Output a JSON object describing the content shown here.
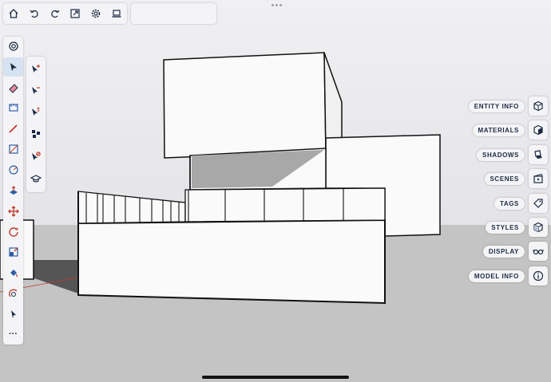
{
  "canvas": {
    "sky_color": "#e8e8ec",
    "ground_color": "#c4c4c4",
    "accent_color": "#1c2a44"
  },
  "top_toolbar": {
    "items": [
      {
        "icon": "home-icon"
      },
      {
        "icon": "undo-icon"
      },
      {
        "icon": "redo-icon"
      },
      {
        "icon": "export-icon"
      },
      {
        "icon": "settings-icon"
      },
      {
        "icon": "laptop-icon"
      }
    ],
    "search_value": ""
  },
  "left_toolbar": {
    "items": [
      {
        "icon": "object-info-icon"
      },
      {
        "icon": "select-tool-icon",
        "active": true
      },
      {
        "icon": "eraser-icon"
      },
      {
        "icon": "tape-measure-icon"
      },
      {
        "icon": "pencil-icon"
      },
      {
        "icon": "rectangle-icon"
      },
      {
        "icon": "circle-icon"
      },
      {
        "icon": "push-pull-icon"
      },
      {
        "icon": "move-icon"
      },
      {
        "icon": "rotate-icon"
      },
      {
        "icon": "scale-icon"
      },
      {
        "icon": "paint-bucket-icon"
      },
      {
        "icon": "orbit-icon"
      },
      {
        "icon": "arrow-cursor-icon"
      },
      {
        "icon": "more-icon",
        "label": "···"
      }
    ]
  },
  "sub_toolbar": {
    "items": [
      {
        "icon": "select-add-icon"
      },
      {
        "icon": "select-subtract-icon"
      },
      {
        "icon": "select-toggle-icon"
      },
      {
        "icon": "select-all-icon"
      },
      {
        "icon": "select-none-icon"
      },
      {
        "icon": "learn-icon"
      }
    ]
  },
  "right_panels": [
    {
      "label": "ENTITY INFO",
      "icon": "entity-info-icon"
    },
    {
      "label": "MATERIALS",
      "icon": "materials-icon"
    },
    {
      "label": "SHADOWS",
      "icon": "shadows-icon"
    },
    {
      "label": "SCENES",
      "icon": "scenes-icon"
    },
    {
      "label": "TAGS",
      "icon": "tags-icon"
    },
    {
      "label": "STYLES",
      "icon": "styles-icon"
    },
    {
      "label": "DISPLAY",
      "icon": "display-icon"
    },
    {
      "label": "MODEL INFO",
      "icon": "model-info-icon"
    }
  ]
}
